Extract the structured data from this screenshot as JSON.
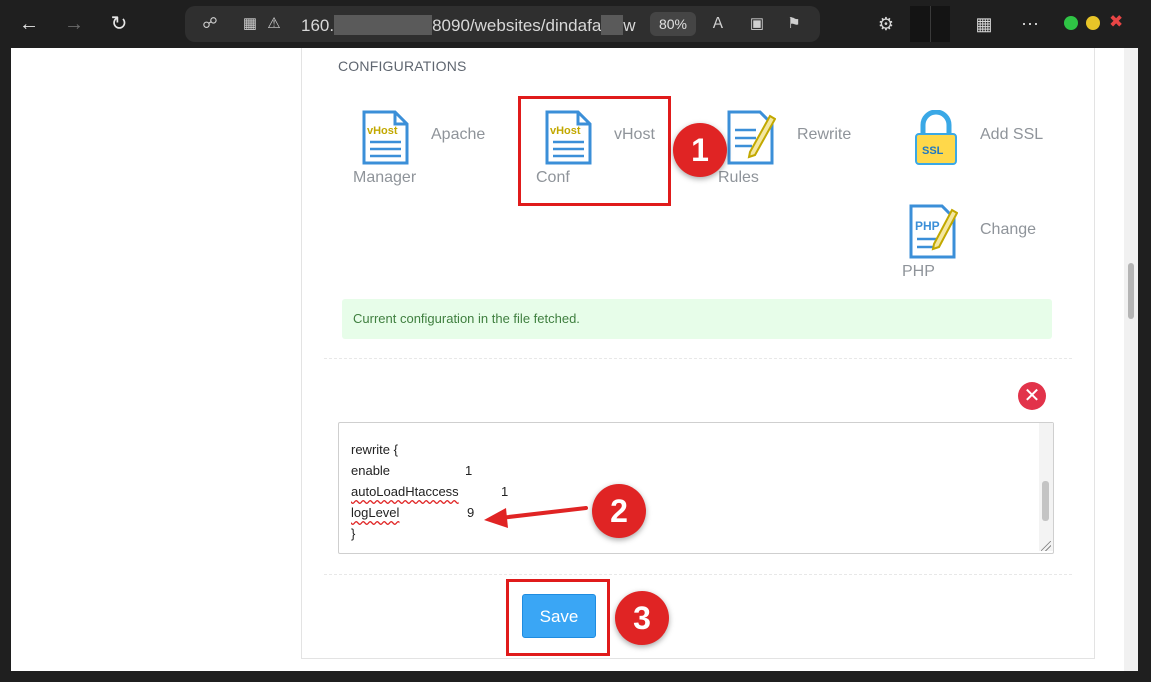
{
  "browser": {
    "url_prefix": "160.",
    "url_mid": "8090/websites/dindafa",
    "url_suffix": "w",
    "zoom": "80%"
  },
  "page": {
    "section_title": "CONFIGURATIONS",
    "items": [
      {
        "label1": "Apache",
        "label2": "Manager",
        "icon_text": "vHost"
      },
      {
        "label1": "vHost",
        "label2": "Conf",
        "icon_text": "vHost"
      },
      {
        "label1": "Rewrite",
        "label2": "Rules"
      },
      {
        "label1": "Add SSL",
        "label2": "",
        "icon_text": "SSL"
      },
      {
        "label1": "Change",
        "label2": "PHP",
        "icon_text": "PHP"
      }
    ],
    "alert": "Current configuration in the file fetched.",
    "editor_lines": [
      "rewrite  {",
      "  enable",
      "1",
      "  autoLoadHtaccess",
      "1",
      "  logLevel",
      "9",
      "}"
    ],
    "save_label": "Save"
  },
  "annotations": {
    "step1": "1",
    "step2": "2",
    "step3": "3",
    "highlight_color": "#e01b1b"
  },
  "colors": {
    "accent": "#3aa6f5",
    "alert_bg": "#e7fde9",
    "alert_text": "#3f7f3f",
    "danger": "#e2334a"
  }
}
